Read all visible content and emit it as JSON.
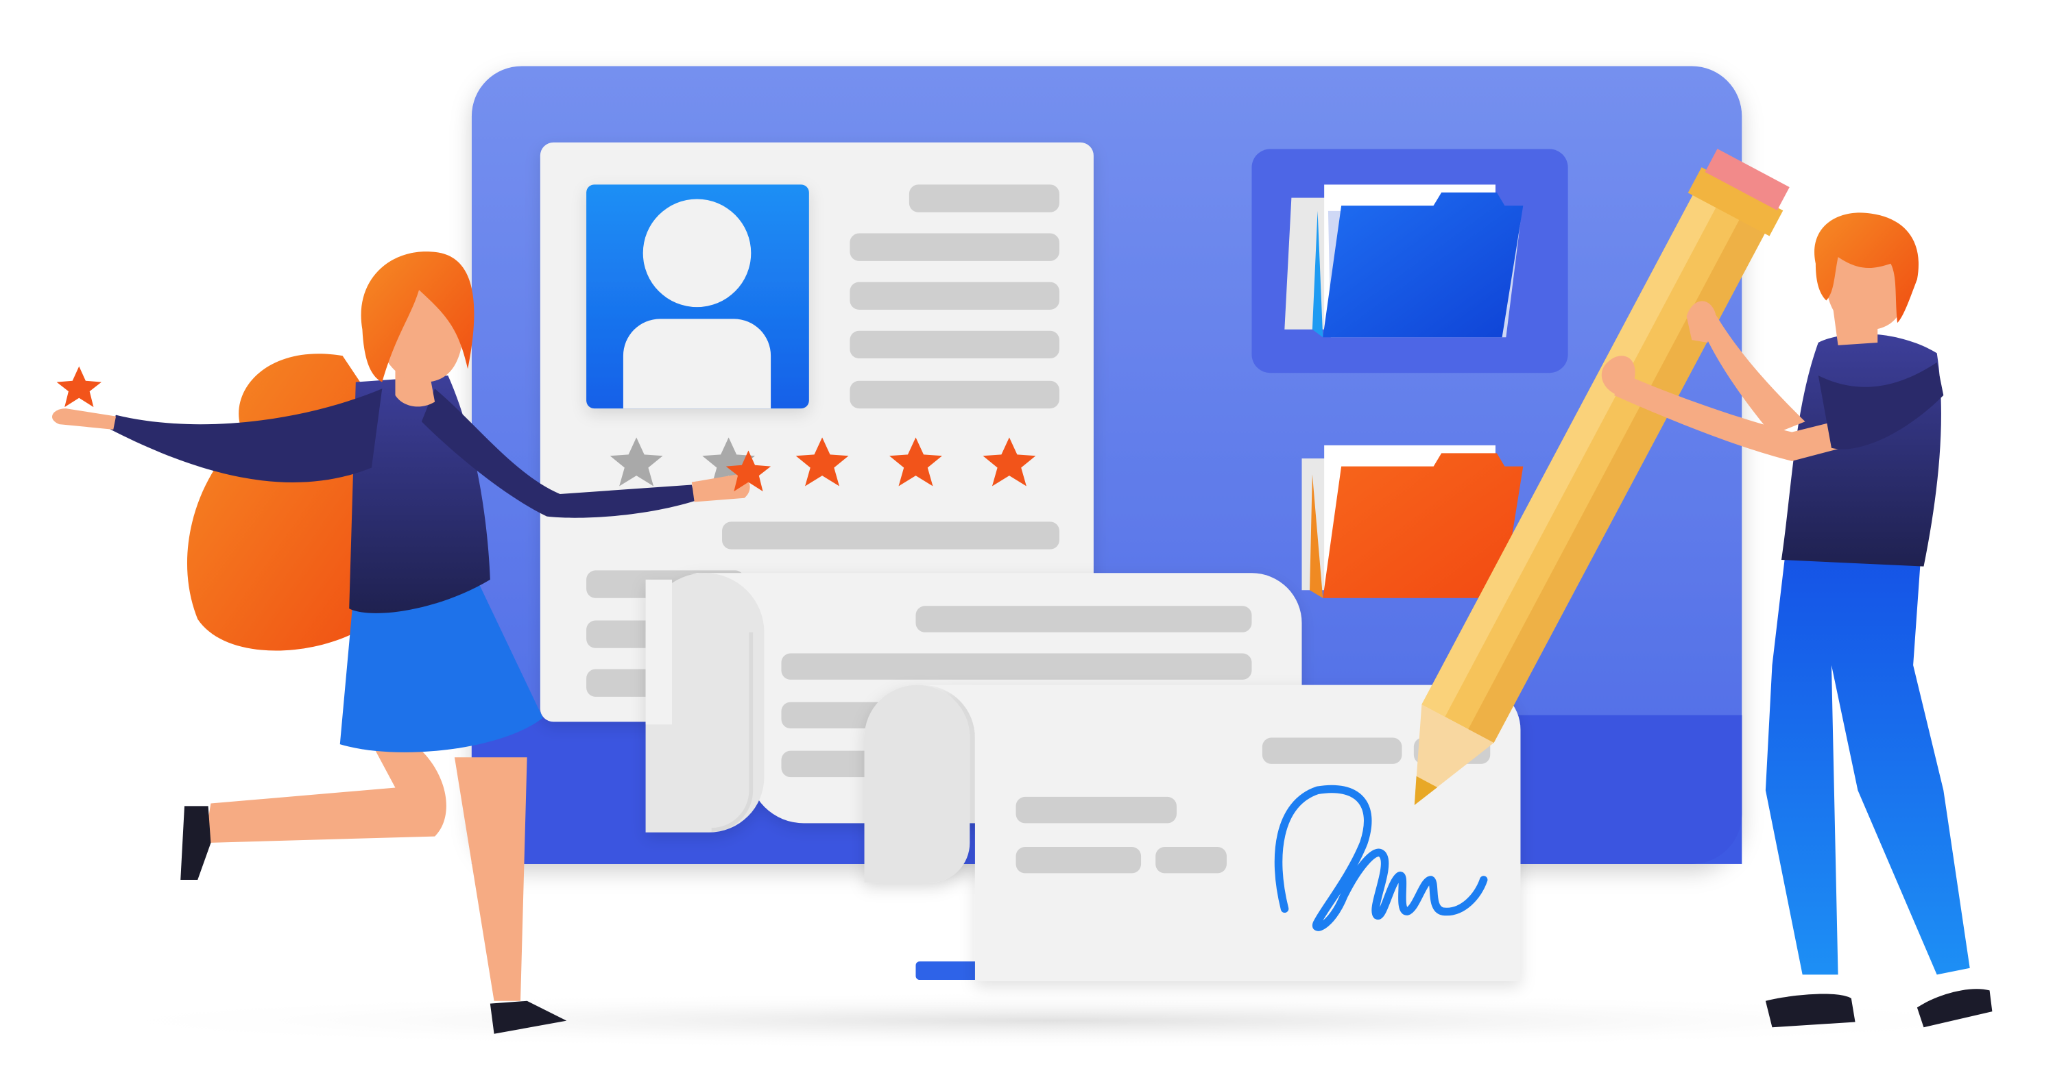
{
  "scene": {
    "subject": "profile-rating-and-contract-signing-illustration",
    "profile_card": {
      "rating": 3,
      "max_rating": 5
    },
    "folders": [
      {
        "name": "blue-folder",
        "color": "#1e6ff0"
      },
      {
        "name": "orange-folder",
        "color": "#f2541a"
      }
    ],
    "signature": {
      "style": "handwritten",
      "color": "#1f7ef2"
    }
  },
  "colors": {
    "monitor": "#5f7fec",
    "monitor_dark": "#3d5fe3",
    "paper": "#f2f2f2",
    "line": "#cfcfcf",
    "orange": "#f2541a",
    "blue": "#1e7af0",
    "navy": "#25275e",
    "skin": "#f6ab83",
    "pencil": "#f6c35a"
  }
}
